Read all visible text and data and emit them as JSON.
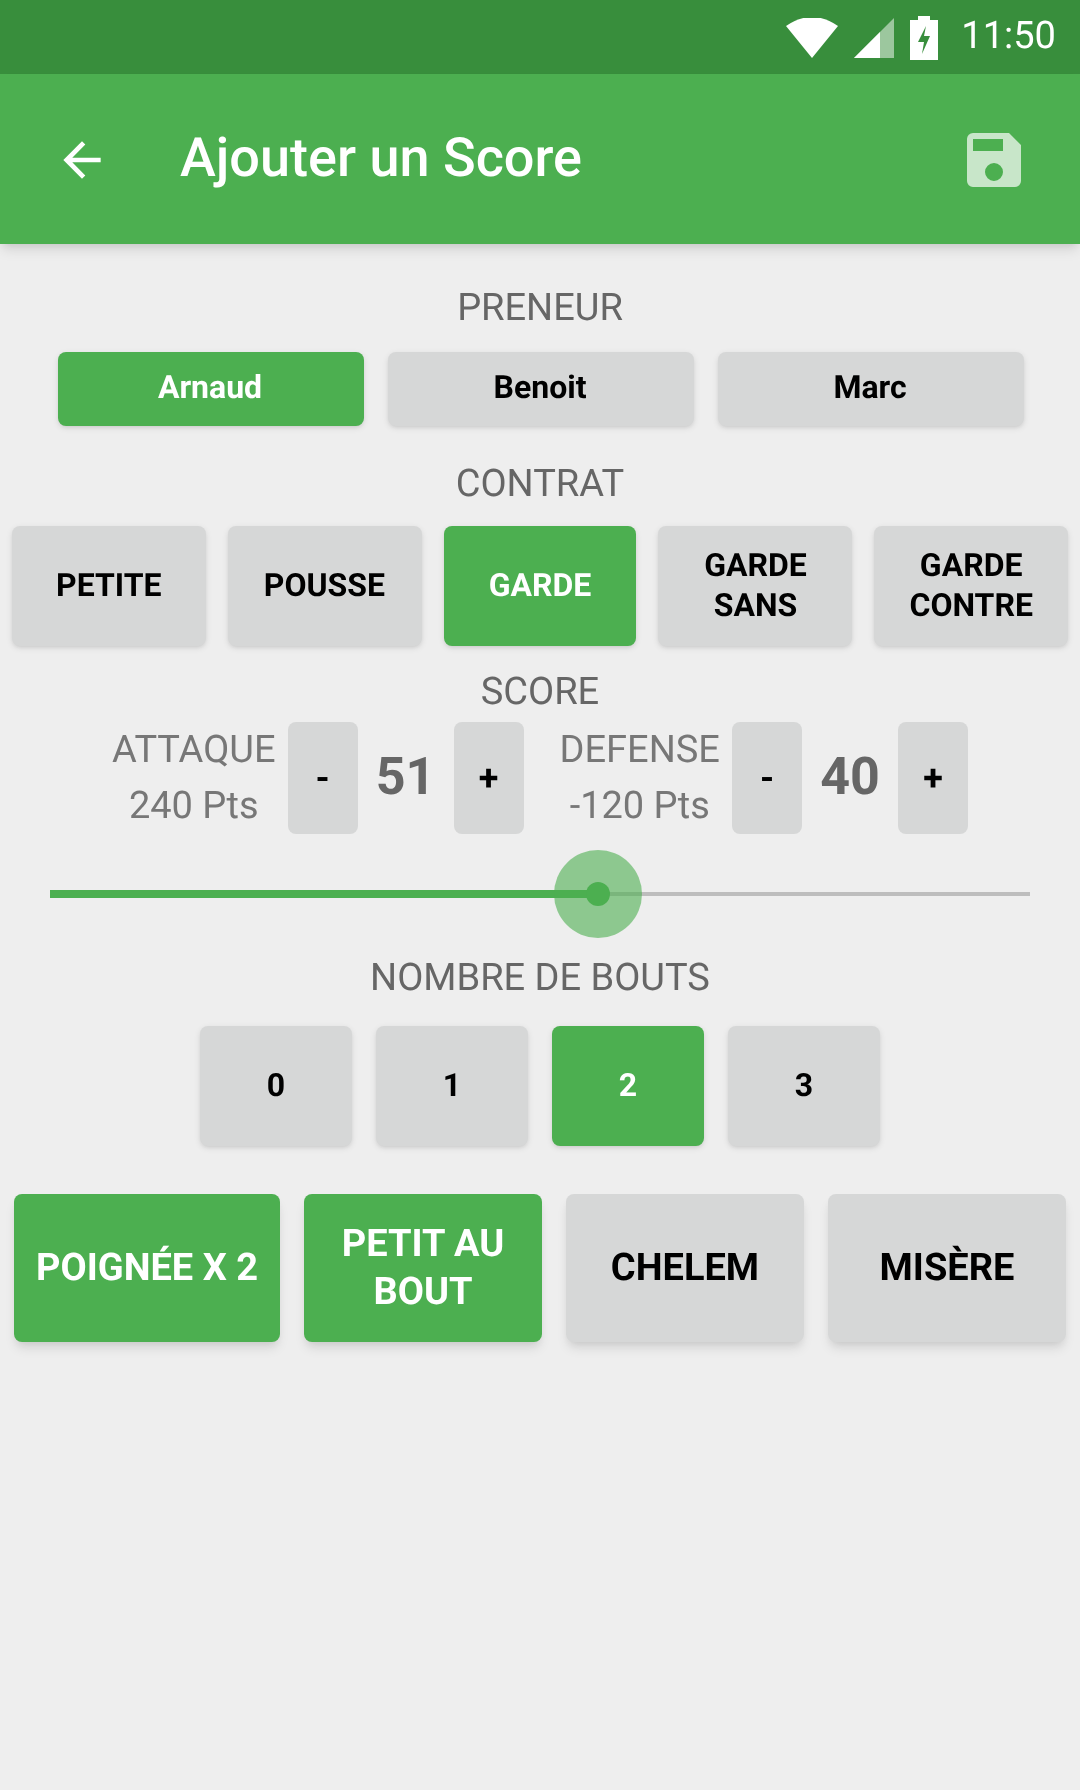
{
  "status_bar": {
    "time": "11:50"
  },
  "toolbar": {
    "title": "Ajouter un Score"
  },
  "preneur": {
    "label": "PRENEUR",
    "players": [
      {
        "label": "Arnaud",
        "selected": true
      },
      {
        "label": "Benoit",
        "selected": false
      },
      {
        "label": "Marc",
        "selected": false
      }
    ]
  },
  "contrat": {
    "label": "CONTRAT",
    "options": [
      {
        "label": "PETITE",
        "selected": false
      },
      {
        "label": "POUSSE",
        "selected": false
      },
      {
        "label": "GARDE",
        "selected": true
      },
      {
        "label": "GARDE SANS",
        "selected": false
      },
      {
        "label": "GARDE CONTRE",
        "selected": false
      }
    ]
  },
  "score": {
    "label": "SCORE",
    "sides": [
      {
        "team": "ATTAQUE",
        "points": "240 Pts",
        "minus": "-",
        "score": "51",
        "plus": "+"
      },
      {
        "team": "DEFENSE",
        "points": "-120 Pts",
        "minus": "-",
        "score": "40",
        "plus": "+"
      }
    ],
    "slider": {
      "level": 0.56
    }
  },
  "bouts": {
    "label": "NOMBRE DE BOUTS",
    "options": [
      {
        "label": "0",
        "selected": false
      },
      {
        "label": "1",
        "selected": false
      },
      {
        "label": "2",
        "selected": true
      },
      {
        "label": "3",
        "selected": false
      }
    ]
  },
  "bonuses": [
    {
      "label": "POIGNÉE X 2",
      "selected": true
    },
    {
      "label": "PETIT AU BOUT",
      "selected": true
    },
    {
      "label": "CHELEM",
      "selected": false
    },
    {
      "label": "MISÈRE",
      "selected": false
    }
  ]
}
